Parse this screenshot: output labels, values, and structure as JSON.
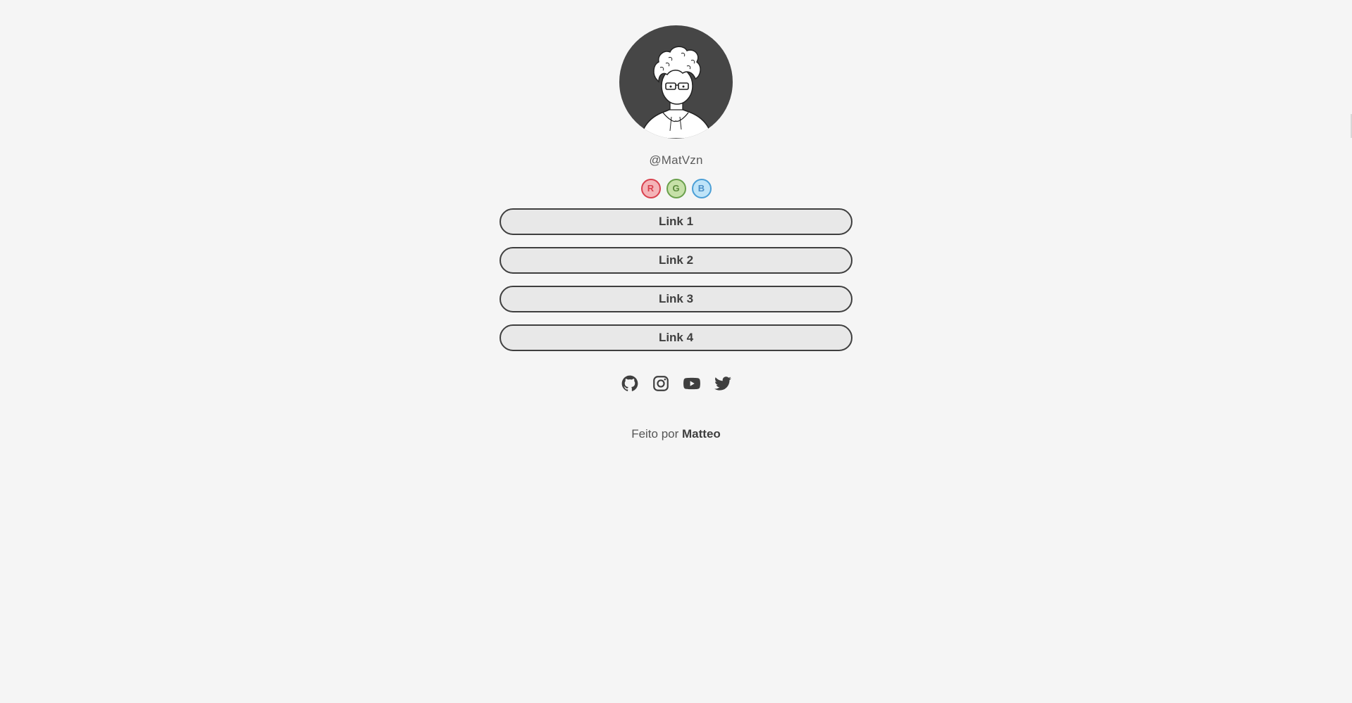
{
  "profile": {
    "handle": "@MatVzn"
  },
  "themes": [
    {
      "label": "R",
      "color": "#d9414e"
    },
    {
      "label": "G",
      "color": "#6aa04c"
    },
    {
      "label": "B",
      "color": "#4b9fd6"
    }
  ],
  "links": [
    {
      "label": "Link 1"
    },
    {
      "label": "Link 2"
    },
    {
      "label": "Link 3"
    },
    {
      "label": "Link 4"
    }
  ],
  "socials": [
    {
      "icon": "github-icon"
    },
    {
      "icon": "instagram-icon"
    },
    {
      "icon": "youtube-icon"
    },
    {
      "icon": "twitter-icon"
    }
  ],
  "footer": {
    "prefix": "Feito por",
    "author": "Matteo"
  },
  "colors": {
    "background": "#f5f5f5",
    "primary": "#3f3f3f",
    "button_fill": "#e8e8e8",
    "avatar_bg": "#464646"
  }
}
